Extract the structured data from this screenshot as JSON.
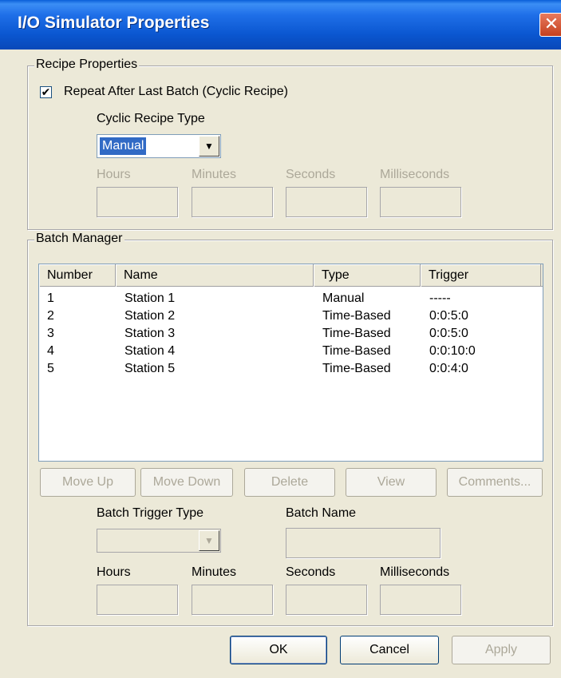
{
  "window": {
    "title": "I/O Simulator Properties",
    "close_label": "✕"
  },
  "recipe": {
    "group_label": "Recipe Properties",
    "repeat_checkbox_label": "Repeat After Last Batch (Cyclic Recipe)",
    "repeat_checked": true,
    "checkbox_mark": "✔",
    "cyclic_type_label": "Cyclic Recipe Type",
    "cyclic_type_value": "Manual",
    "dropdown_arrow": "▼",
    "time_labels": {
      "hours": "Hours",
      "minutes": "Minutes",
      "seconds": "Seconds",
      "milliseconds": "Milliseconds"
    }
  },
  "batch_manager": {
    "group_label": "Batch Manager",
    "columns": [
      "Number",
      "Name",
      "Type",
      "Trigger"
    ],
    "rows": [
      [
        "1",
        "Station 1",
        "Manual",
        "-----"
      ],
      [
        "2",
        "Station 2",
        "Time-Based",
        "0:0:5:0"
      ],
      [
        "3",
        "Station 3",
        "Time-Based",
        "0:0:5:0"
      ],
      [
        "4",
        "Station 4",
        "Time-Based",
        "0:0:10:0"
      ],
      [
        "5",
        "Station 5",
        "Time-Based",
        "0:0:4:0"
      ]
    ],
    "buttons": {
      "move_up": "Move Up",
      "move_down": "Move Down",
      "delete": "Delete",
      "view": "View",
      "comments": "Comments..."
    },
    "batch_trigger_type_label": "Batch Trigger Type",
    "batch_name_label": "Batch Name",
    "time_labels": {
      "hours": "Hours",
      "minutes": "Minutes",
      "seconds": "Seconds",
      "milliseconds": "Milliseconds"
    }
  },
  "dialog_buttons": {
    "ok": "OK",
    "cancel": "Cancel",
    "apply": "Apply"
  }
}
